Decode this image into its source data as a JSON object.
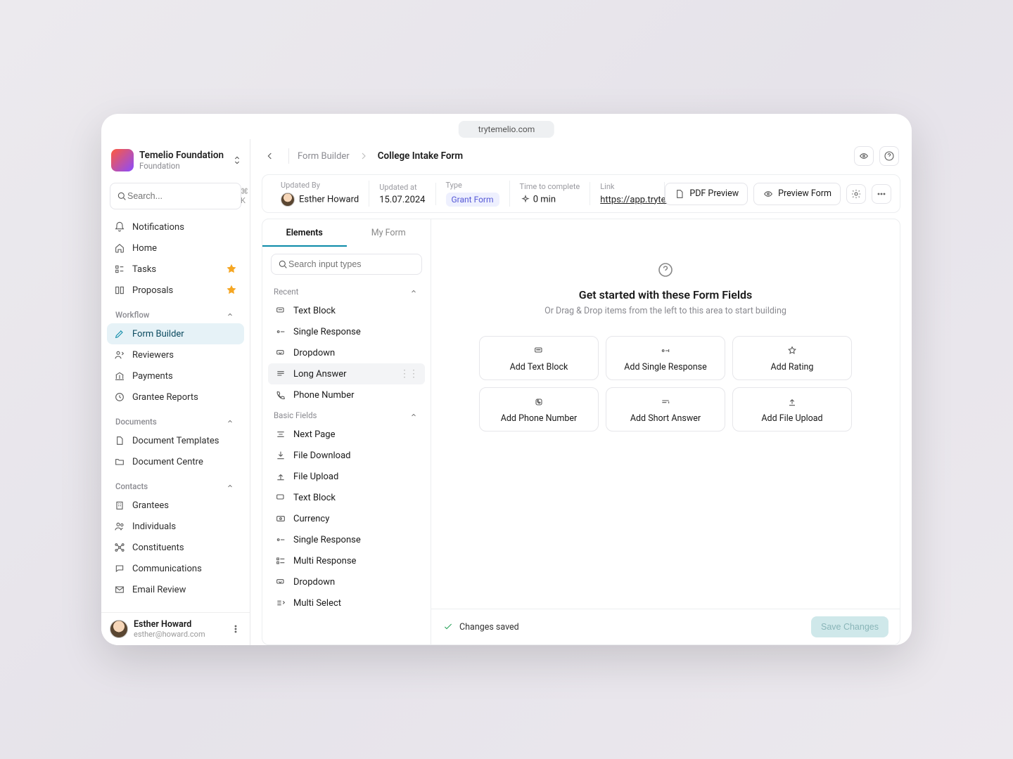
{
  "browser": {
    "url": "trytemelio.com"
  },
  "org": {
    "name": "Temelio Foundation",
    "subtitle": "Foundation"
  },
  "sidebar": {
    "search_placeholder": "Search...",
    "search_kbd": "⌘ K",
    "top": [
      {
        "label": "Notifications"
      },
      {
        "label": "Home"
      },
      {
        "label": "Tasks",
        "starred": true
      },
      {
        "label": "Proposals",
        "starred": true
      }
    ],
    "sections": {
      "workflow": {
        "title": "Workflow",
        "items": [
          {
            "label": "Form Builder",
            "active": true
          },
          {
            "label": "Reviewers"
          },
          {
            "label": "Payments"
          },
          {
            "label": "Grantee Reports"
          }
        ]
      },
      "documents": {
        "title": "Documents",
        "items": [
          {
            "label": "Document Templates"
          },
          {
            "label": "Document Centre"
          }
        ]
      },
      "contacts": {
        "title": "Contacts",
        "items": [
          {
            "label": "Grantees"
          },
          {
            "label": "Individuals"
          },
          {
            "label": "Constituents"
          },
          {
            "label": "Communications"
          },
          {
            "label": "Email Review"
          }
        ]
      }
    }
  },
  "user": {
    "name": "Esther Howard",
    "email": "esther@howard.com"
  },
  "breadcrumb": {
    "parent": "Form Builder",
    "current": "College Intake Form"
  },
  "meta": {
    "updated_by_label": "Updated By",
    "updated_by": "Esther Howard",
    "updated_at_label": "Updated at",
    "updated_at": "15.07.2024",
    "type_label": "Type",
    "type": "Grant Form",
    "time_label": "Time to complete",
    "time": "0 min",
    "link_label": "Link",
    "link": "https://app.trytemelio..."
  },
  "actions": {
    "pdf_preview": "PDF Preview",
    "preview_form": "Preview Form"
  },
  "panel": {
    "tabs": {
      "elements": "Elements",
      "myform": "My Form"
    },
    "search_placeholder": "Search input types",
    "groups": {
      "recent": {
        "title": "Recent",
        "items": [
          {
            "label": "Text Block"
          },
          {
            "label": "Single Response"
          },
          {
            "label": "Dropdown"
          },
          {
            "label": "Long Answer",
            "hover": true
          },
          {
            "label": "Phone Number"
          }
        ]
      },
      "basic": {
        "title": "Basic Fields",
        "items": [
          {
            "label": "Next Page"
          },
          {
            "label": "File Download"
          },
          {
            "label": "File Upload"
          },
          {
            "label": "Text Block"
          },
          {
            "label": "Currency"
          },
          {
            "label": "Single Response"
          },
          {
            "label": "Multi Response"
          },
          {
            "label": "Dropdown"
          },
          {
            "label": "Multi Select"
          }
        ]
      }
    }
  },
  "canvas": {
    "title": "Get started with these Form Fields",
    "subtitle": "Or Drag & Drop items from the left to this area to start building",
    "fields": [
      {
        "label": "Add Text Block"
      },
      {
        "label": "Add Single Response"
      },
      {
        "label": "Add Rating"
      },
      {
        "label": "Add Phone Number"
      },
      {
        "label": "Add Short Answer"
      },
      {
        "label": "Add File Upload"
      }
    ]
  },
  "status": {
    "text": "Changes saved",
    "save_button": "Save Changes"
  }
}
